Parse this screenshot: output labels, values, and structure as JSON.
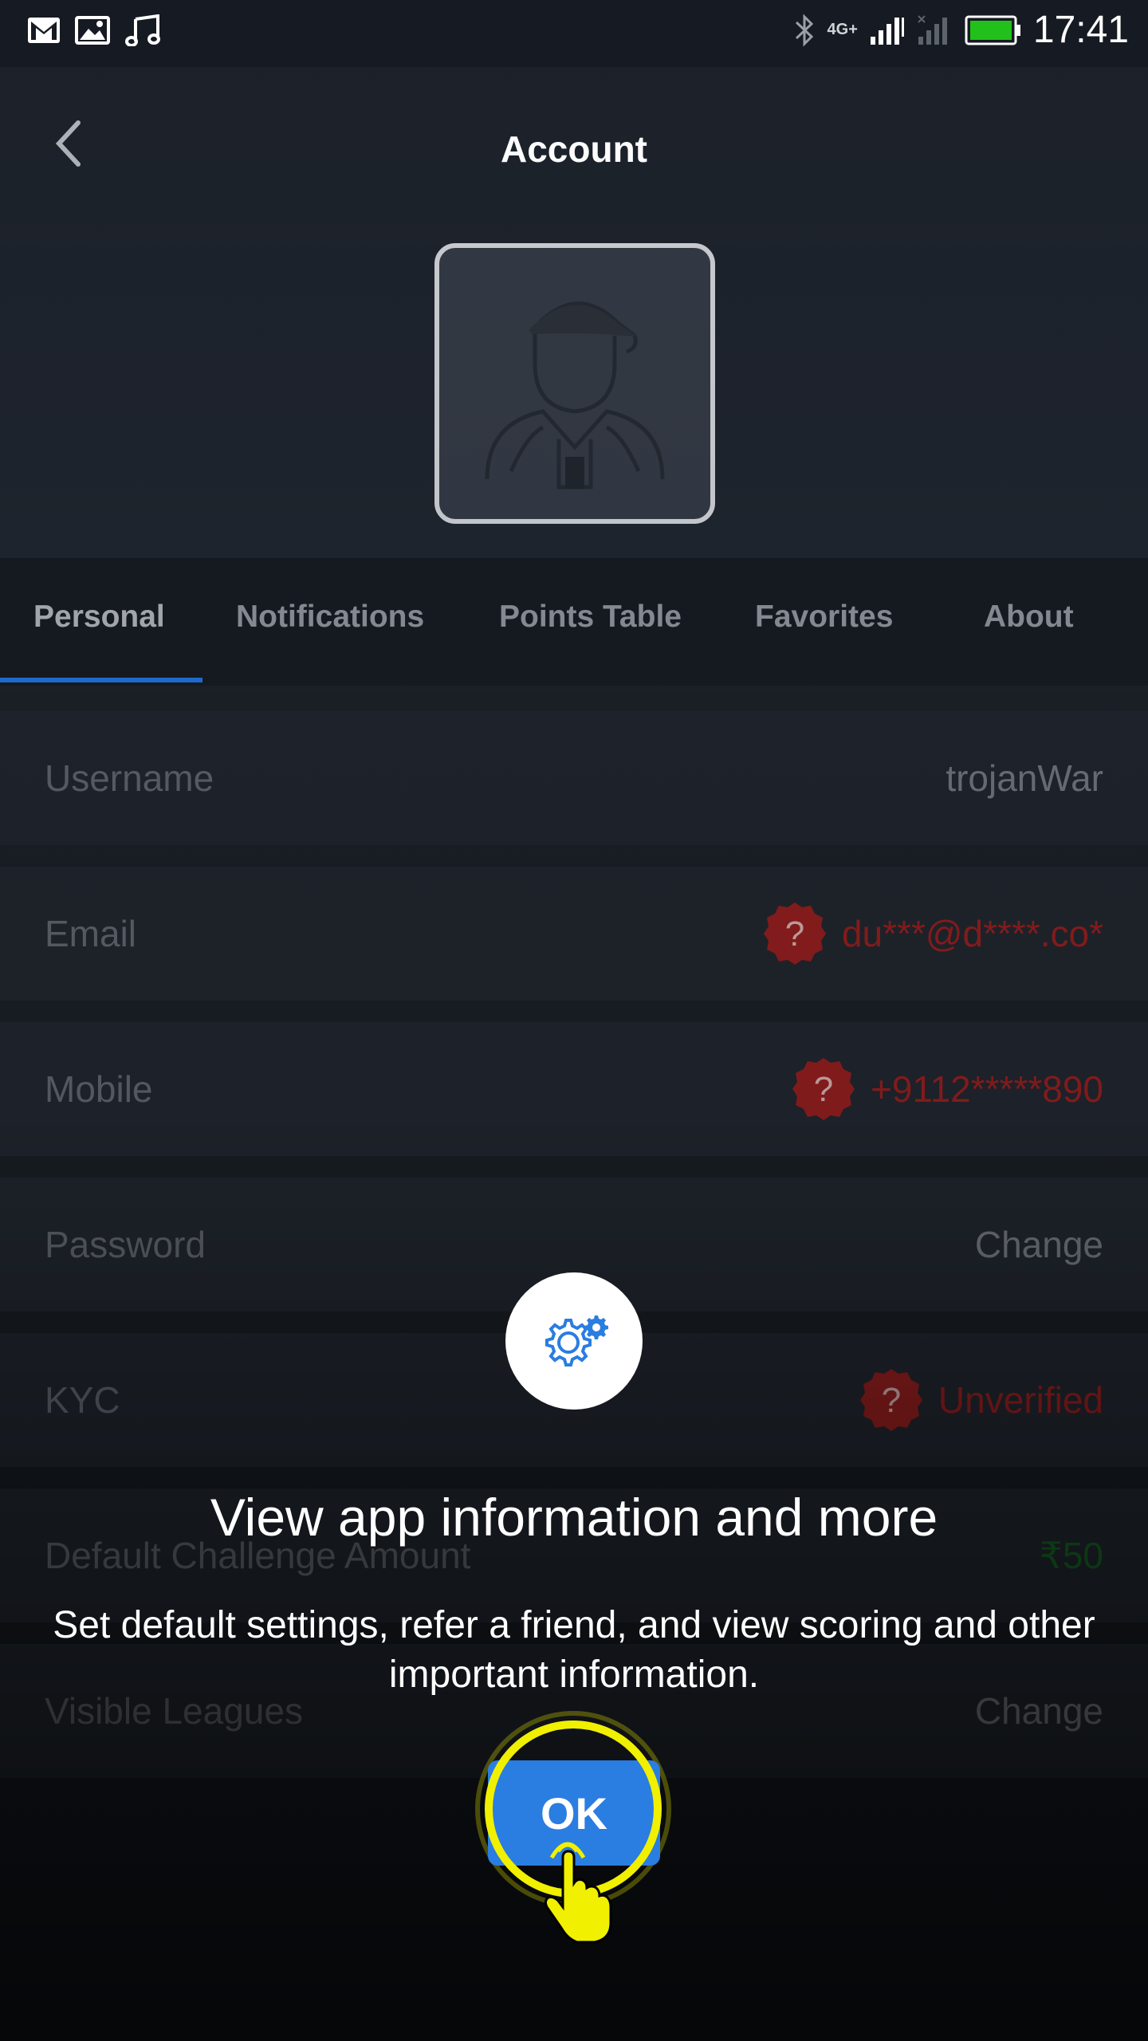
{
  "status_bar": {
    "time": "17:41",
    "network": "4G+",
    "notification_icons": [
      "gmail-icon",
      "gallery-icon",
      "music-icon"
    ]
  },
  "header": {
    "title": "Account",
    "back_icon": "chevron-left-icon"
  },
  "tabs": [
    {
      "label": "Personal",
      "active": true
    },
    {
      "label": "Notifications",
      "active": false
    },
    {
      "label": "Points Table",
      "active": false
    },
    {
      "label": "Favorites",
      "active": false
    },
    {
      "label": "About",
      "active": false
    }
  ],
  "rows": [
    {
      "label": "Username",
      "value": "trojanWar",
      "status": "normal"
    },
    {
      "label": "Email",
      "value": "du***@d****.co*",
      "status": "unverified"
    },
    {
      "label": "Mobile",
      "value": "+9112*****890",
      "status": "unverified"
    },
    {
      "label": "Password",
      "value": "Change",
      "status": "normal"
    },
    {
      "label": "KYC",
      "value": "Unverified",
      "status": "unverified"
    },
    {
      "label": "Default Challenge Amount",
      "value": "₹50",
      "status": "green"
    },
    {
      "label": "Visible Leagues",
      "value": "Change",
      "status": "normal"
    }
  ],
  "coachmark": {
    "icon": "settings-gear-icon",
    "title": "View app information and more",
    "description": "Set default settings, refer a friend, and view scoring and other important information.",
    "ok_label": "OK"
  },
  "colors": {
    "accent": "#2a7de1",
    "tab_indicator": "#1f6fd6",
    "warning_red": "#8b1d1d",
    "highlight_yellow": "#f0f000",
    "amount_green": "#155c22"
  }
}
